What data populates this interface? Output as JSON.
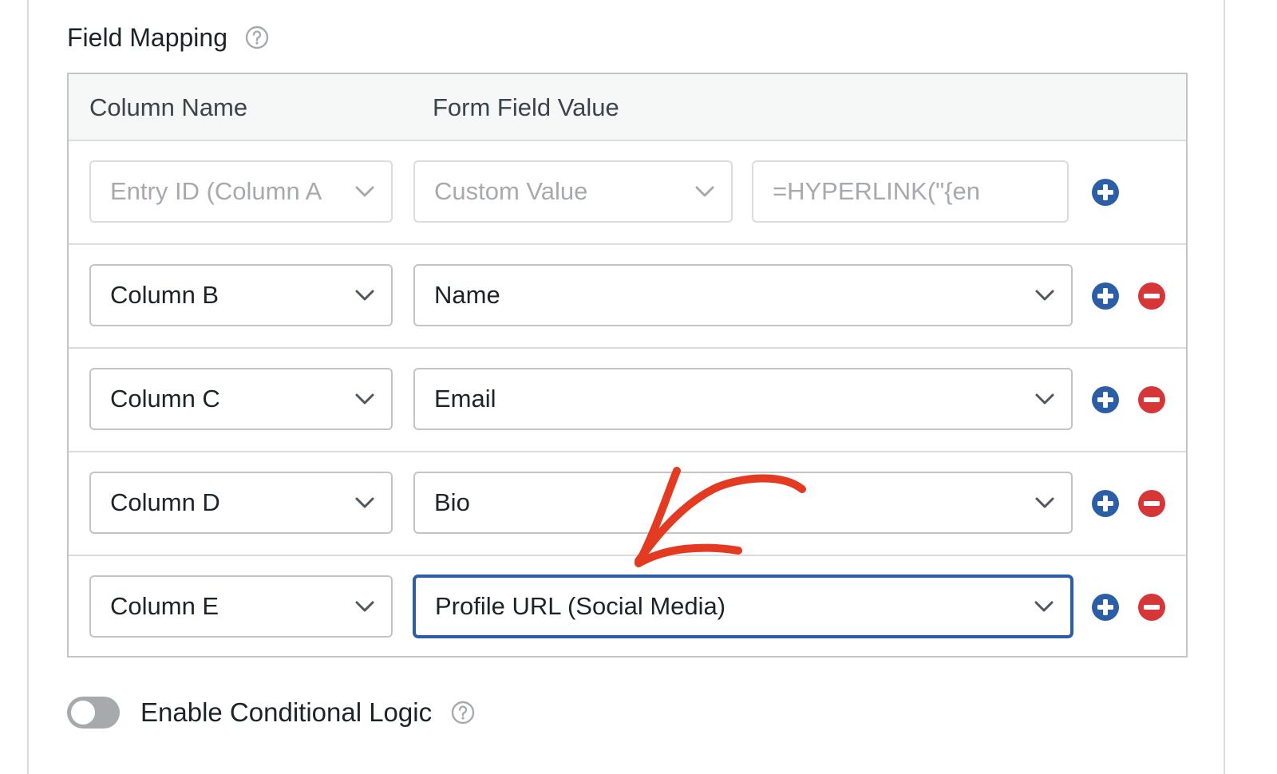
{
  "section": {
    "title": "Field Mapping"
  },
  "table": {
    "headers": {
      "column_name": "Column Name",
      "form_field_value": "Form Field Value"
    },
    "rows": [
      {
        "column": "Entry ID (Column A",
        "field": "Custom Value",
        "custom_value": "=HYPERLINK(\"{en",
        "disabled": true
      },
      {
        "column": "Column B",
        "field": "Name"
      },
      {
        "column": "Column C",
        "field": "Email"
      },
      {
        "column": "Column D",
        "field": "Bio"
      },
      {
        "column": "Column E",
        "field": "Profile URL (Social Media)",
        "focused": true
      }
    ]
  },
  "conditional_logic": {
    "label": "Enable Conditional Logic",
    "enabled": false
  },
  "colors": {
    "add_button": "#2c5ea8",
    "remove_button": "#d63638",
    "focus_border": "#2c5ea8",
    "annotation_arrow": "#e53a22"
  }
}
